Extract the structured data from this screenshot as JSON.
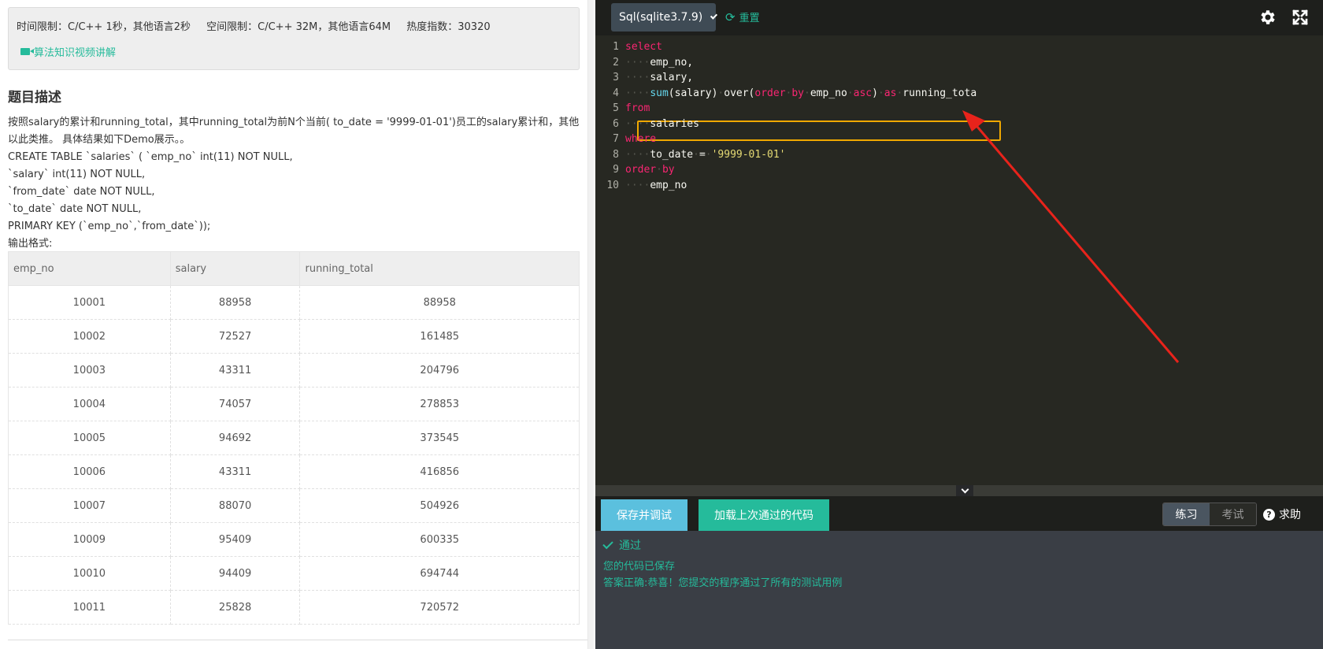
{
  "problem": {
    "limits": {
      "time": "时间限制：C/C++ 1秒，其他语言2秒",
      "space": "空间限制：C/C++ 32M，其他语言64M",
      "heat": "热度指数：30320"
    },
    "video_link": "算法知识视频讲解",
    "section_title": "题目描述",
    "description_lines": [
      "按照salary的累计和running_total，其中running_total为前N个当前( to_date = '9999-01-01')员工的salary累计和，其他",
      "以此类推。 具体结果如下Demo展示。。",
      "CREATE TABLE `salaries` ( `emp_no` int(11) NOT NULL,",
      "`salary` int(11) NOT NULL,",
      "`from_date` date NOT NULL,",
      "`to_date` date NOT NULL,",
      "PRIMARY KEY (`emp_no`,`from_date`));",
      "输出格式:"
    ],
    "table": {
      "headers": [
        "emp_no",
        "salary",
        "running_total"
      ],
      "rows": [
        [
          "10001",
          "88958",
          "88958"
        ],
        [
          "10002",
          "72527",
          "161485"
        ],
        [
          "10003",
          "43311",
          "204796"
        ],
        [
          "10004",
          "74057",
          "278853"
        ],
        [
          "10005",
          "94692",
          "373545"
        ],
        [
          "10006",
          "43311",
          "416856"
        ],
        [
          "10007",
          "88070",
          "504926"
        ],
        [
          "10009",
          "95409",
          "600335"
        ],
        [
          "10010",
          "94409",
          "694744"
        ],
        [
          "10011",
          "25828",
          "720572"
        ]
      ]
    }
  },
  "editor": {
    "language": "Sql(sqlite3.7.9)",
    "reset_label": "重置",
    "lines": [
      {
        "n": "1",
        "tokens": [
          [
            "kw",
            "select"
          ]
        ]
      },
      {
        "n": "2",
        "tokens": [
          [
            "ws",
            "····"
          ],
          [
            "id",
            "emp_no,"
          ]
        ]
      },
      {
        "n": "3",
        "tokens": [
          [
            "ws",
            "····"
          ],
          [
            "id",
            "salary,"
          ]
        ]
      },
      {
        "n": "4",
        "tokens": [
          [
            "ws",
            "····"
          ],
          [
            "fn",
            "sum"
          ],
          [
            "id",
            "(salary)"
          ],
          [
            "ws",
            "·"
          ],
          [
            "id",
            "over("
          ],
          [
            "kw",
            "order"
          ],
          [
            "ws",
            "·"
          ],
          [
            "kw",
            "by"
          ],
          [
            "ws",
            "·"
          ],
          [
            "id",
            "emp_no"
          ],
          [
            "ws",
            "·"
          ],
          [
            "kw",
            "asc"
          ],
          [
            "id",
            ")"
          ],
          [
            "ws",
            "·"
          ],
          [
            "kw",
            "as"
          ],
          [
            "ws",
            "·"
          ],
          [
            "id",
            "running_tota"
          ]
        ]
      },
      {
        "n": "5",
        "tokens": [
          [
            "kw",
            "from"
          ]
        ]
      },
      {
        "n": "6",
        "tokens": [
          [
            "ws",
            "····"
          ],
          [
            "id",
            "salaries"
          ]
        ]
      },
      {
        "n": "7",
        "tokens": [
          [
            "kw",
            "where"
          ]
        ]
      },
      {
        "n": "8",
        "tokens": [
          [
            "ws",
            "····"
          ],
          [
            "id",
            "to_date"
          ],
          [
            "ws",
            "·"
          ],
          [
            "id",
            "="
          ],
          [
            "ws",
            "·"
          ],
          [
            "str",
            "'9999-01-01'"
          ]
        ]
      },
      {
        "n": "9",
        "tokens": [
          [
            "kw",
            "order"
          ],
          [
            "ws",
            "·"
          ],
          [
            "kw",
            "by"
          ]
        ]
      },
      {
        "n": "10",
        "tokens": [
          [
            "ws",
            "····"
          ],
          [
            "id",
            "emp_no"
          ]
        ]
      }
    ]
  },
  "actions": {
    "save_debug": "保存并调试",
    "load_last": "加载上次通过的代码",
    "mode_practice": "练习",
    "mode_exam": "考试",
    "help": "求助"
  },
  "output": {
    "status": "通过",
    "saved": "您的代码已保存",
    "result": "答案正确:恭喜！您提交的程序通过了所有的测试用例"
  },
  "colors": {
    "accent_green": "#25bb9b",
    "save_blue": "#5bc0de",
    "highlight_orange": "#f0a800",
    "arrow_red": "#e8231b"
  }
}
